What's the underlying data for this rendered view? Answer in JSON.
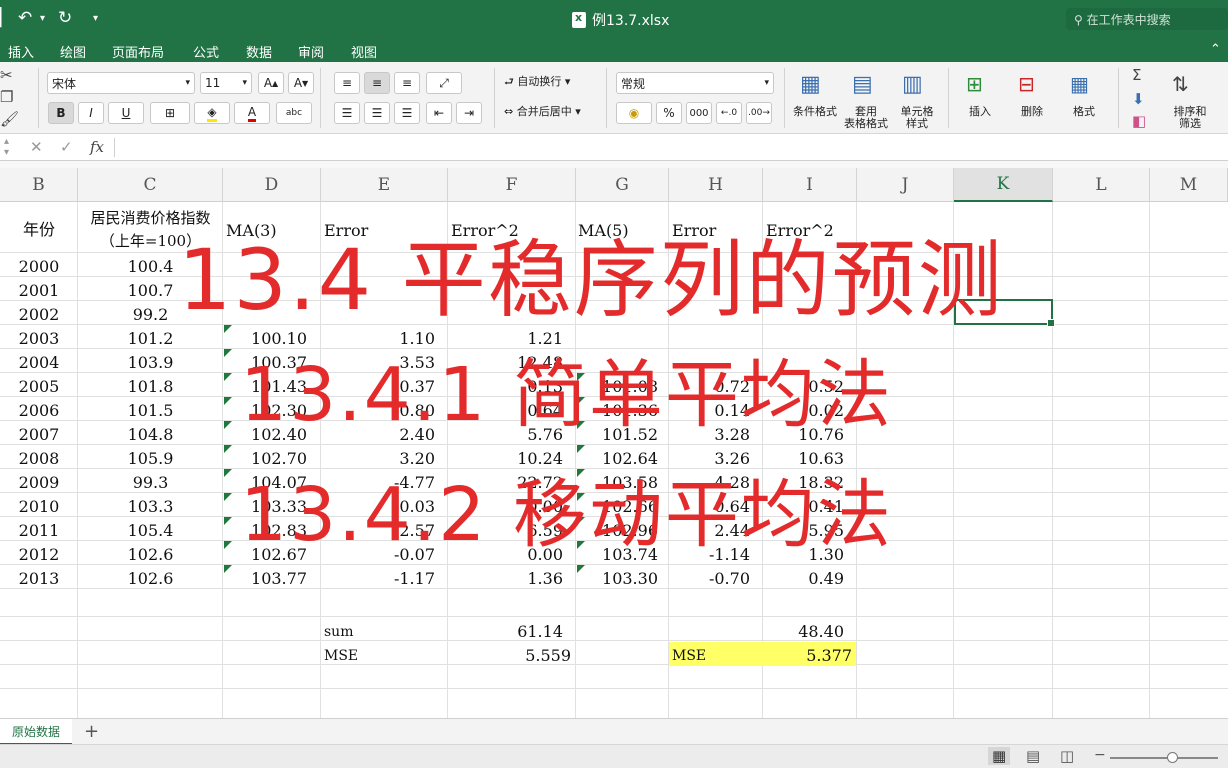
{
  "window": {
    "title": "例13.7.xlsx",
    "search_placeholder": "在工作表中搜索"
  },
  "menu": [
    "插入",
    "绘图",
    "页面布局",
    "公式",
    "数据",
    "审阅",
    "视图"
  ],
  "ribbon": {
    "font_name": "宋体",
    "font_size": "11",
    "bold": "B",
    "italic": "I",
    "underline": "U",
    "wrap_text": "自动换行",
    "merge_center": "合并后居中",
    "number_format": "常规",
    "percent": "%",
    "thousands": "000",
    "cond_format": "条件格式",
    "table_format": "套用\n表格格式",
    "cell_style": "单元格\n样式",
    "insert": "插入",
    "delete": "删除",
    "format": "格式",
    "sort_filter": "排序和\n筛选",
    "font_grow": "A",
    "font_shrink": "A",
    "phonetic": "abc",
    "sum_symbol": "Σ"
  },
  "formula_bar": {
    "fx": "fx"
  },
  "columns": [
    "B",
    "C",
    "D",
    "E",
    "F",
    "G",
    "H",
    "I",
    "J",
    "K",
    "L",
    "M"
  ],
  "table": {
    "headers": {
      "year": "年份",
      "cpi_line1": "居民消费价格指数",
      "cpi_line2": "（上年=100）",
      "ma3": "MA(3)",
      "error3": "Error",
      "error3sq": "Error^2",
      "ma5": "MA(5)",
      "error5": "Error",
      "error5sq": "Error^2"
    },
    "rows": [
      {
        "year": "2000",
        "cpi": "100.4",
        "ma3": "",
        "e3": "",
        "e3sq": "",
        "ma5": "",
        "e5": "",
        "e5sq": ""
      },
      {
        "year": "2001",
        "cpi": "100.7",
        "ma3": "",
        "e3": "",
        "e3sq": "",
        "ma5": "",
        "e5": "",
        "e5sq": ""
      },
      {
        "year": "2002",
        "cpi": "99.2",
        "ma3": "",
        "e3": "",
        "e3sq": "",
        "ma5": "",
        "e5": "",
        "e5sq": ""
      },
      {
        "year": "2003",
        "cpi": "101.2",
        "ma3": "100.10",
        "e3": "1.10",
        "e3sq": "1.21",
        "ma5": "",
        "e5": "",
        "e5sq": ""
      },
      {
        "year": "2004",
        "cpi": "103.9",
        "ma3": "100.37",
        "e3": "3.53",
        "e3sq": "12.48",
        "ma5": "",
        "e5": "",
        "e5sq": ""
      },
      {
        "year": "2005",
        "cpi": "101.8",
        "ma3": "101.43",
        "e3": "0.37",
        "e3sq": "0.13",
        "ma5": "101.08",
        "e5": "0.72",
        "e5sq": "0.52"
      },
      {
        "year": "2006",
        "cpi": "101.5",
        "ma3": "102.30",
        "e3": "-0.80",
        "e3sq": "0.64",
        "ma5": "101.36",
        "e5": "0.14",
        "e5sq": "0.02"
      },
      {
        "year": "2007",
        "cpi": "104.8",
        "ma3": "102.40",
        "e3": "2.40",
        "e3sq": "5.76",
        "ma5": "101.52",
        "e5": "3.28",
        "e5sq": "10.76"
      },
      {
        "year": "2008",
        "cpi": "105.9",
        "ma3": "102.70",
        "e3": "3.20",
        "e3sq": "10.24",
        "ma5": "102.64",
        "e5": "3.26",
        "e5sq": "10.63"
      },
      {
        "year": "2009",
        "cpi": "99.3",
        "ma3": "104.07",
        "e3": "-4.77",
        "e3sq": "22.72",
        "ma5": "103.58",
        "e5": "-4.28",
        "e5sq": "18.32"
      },
      {
        "year": "2010",
        "cpi": "103.3",
        "ma3": "103.33",
        "e3": "-0.03",
        "e3sq": "0.00",
        "ma5": "102.66",
        "e5": "0.64",
        "e5sq": "0.41"
      },
      {
        "year": "2011",
        "cpi": "105.4",
        "ma3": "102.83",
        "e3": "2.57",
        "e3sq": "6.59",
        "ma5": "102.96",
        "e5": "2.44",
        "e5sq": "5.95"
      },
      {
        "year": "2012",
        "cpi": "102.6",
        "ma3": "102.67",
        "e3": "-0.07",
        "e3sq": "0.00",
        "ma5": "103.74",
        "e5": "-1.14",
        "e5sq": "1.30"
      },
      {
        "year": "2013",
        "cpi": "102.6",
        "ma3": "103.77",
        "e3": "-1.17",
        "e3sq": "1.36",
        "ma5": "103.30",
        "e5": "-0.70",
        "e5sq": "0.49"
      }
    ],
    "sum_label": "sum",
    "sum3": "61.14",
    "sum5": "48.40",
    "mse_label": "MSE",
    "mse3": "5.559",
    "mse5_label": "MSE",
    "mse5": "5.377",
    "highlight_color": "#ffff66"
  },
  "overlay": {
    "line1": "13.4 平稳序列的预测",
    "line2": "13.4.1 简单平均法",
    "line3": "13.4.2 移动平均法",
    "color": "#e32b2b"
  },
  "sheets": [
    "原始数据"
  ],
  "add_sheet": "+",
  "accent": "#217346"
}
